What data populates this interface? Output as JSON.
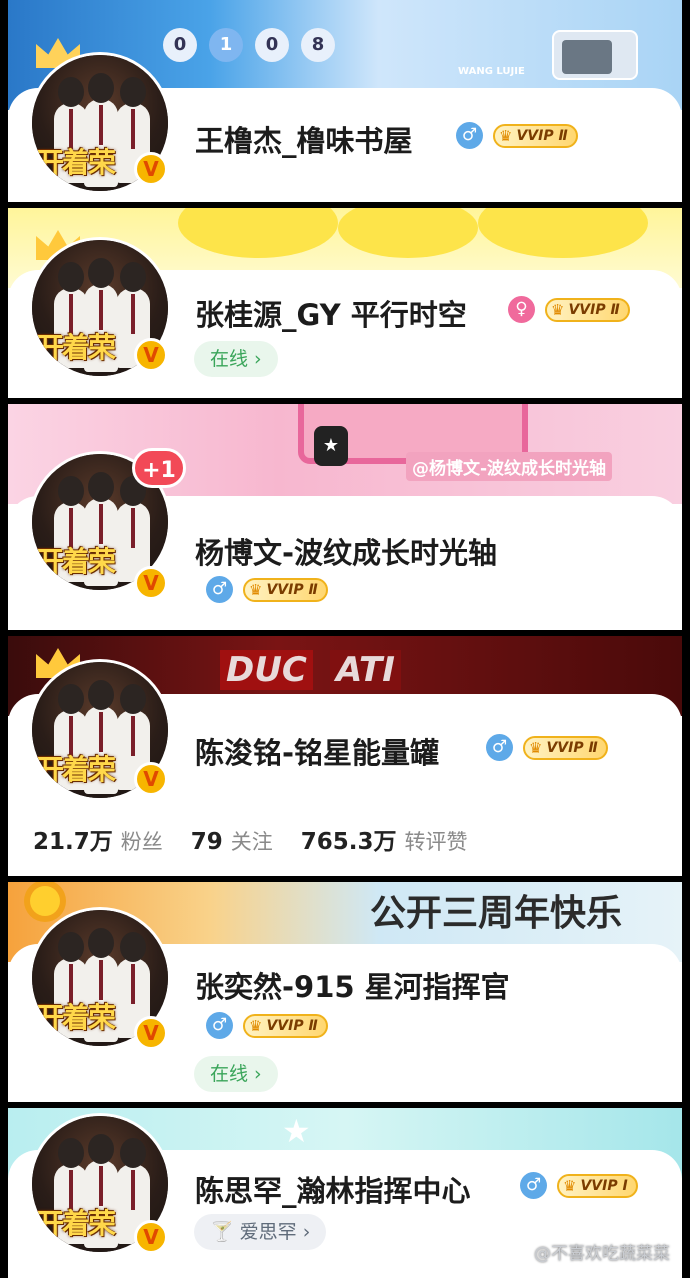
{
  "profiles": [
    {
      "name": "王橹杰_橹味书屋",
      "gender_icon": "♂",
      "vip_label": "VVIP Ⅱ",
      "banner": {
        "digits": [
          "0",
          "1",
          "0",
          "8"
        ],
        "caption": "WANG LUJIE"
      },
      "avatar_caption": "开着荣",
      "verified_badge": "V"
    },
    {
      "name": "张桂源_GY 平行时空",
      "gender_icon": "♀",
      "vip_label": "VVIP Ⅱ",
      "status_pill": "在线 ›",
      "avatar_caption": "开着荣",
      "verified_badge": "V"
    },
    {
      "name": "杨博文-波纹成长时光轴",
      "gender_icon": "♂",
      "vip_label": "VVIP Ⅱ",
      "banner": {
        "caption": "@杨博文-波纹成长时光轴"
      },
      "notification_badge": "+1",
      "avatar_caption": "开着荣",
      "verified_badge": "V"
    },
    {
      "name": "陈浚铭-铭星能量罐",
      "gender_icon": "♂",
      "vip_label": "VVIP Ⅱ",
      "banner": {
        "caption_left": "DUC",
        "caption_right": "ATI"
      },
      "stats": [
        {
          "value": "21.7万",
          "label": "粉丝"
        },
        {
          "value": "79",
          "label": "关注"
        },
        {
          "value": "765.3万",
          "label": "转评赞"
        }
      ],
      "avatar_caption": "开着荣",
      "verified_badge": "V"
    },
    {
      "name": "张奕然-915 星河指挥官",
      "gender_icon": "♂",
      "vip_label": "VVIP Ⅱ",
      "status_pill": "在线 ›",
      "banner": {
        "caption": "公开三周年快乐"
      },
      "avatar_caption": "开着荣",
      "verified_badge": "V"
    },
    {
      "name": "陈思罕_瀚林指挥中心",
      "gender_icon": "♂",
      "vip_label": "VVIP Ⅰ",
      "status_pill": "爱思罕 ›",
      "avatar_caption": "开着荣",
      "verified_badge": "V"
    }
  ],
  "watermark": "@不喜欢吃蔬菜菜",
  "colors": {
    "vip_gold": "#f0b21b",
    "male_blue": "#5ea9e8",
    "female_pink": "#f06a9c",
    "online_green": "#3aa55a"
  }
}
